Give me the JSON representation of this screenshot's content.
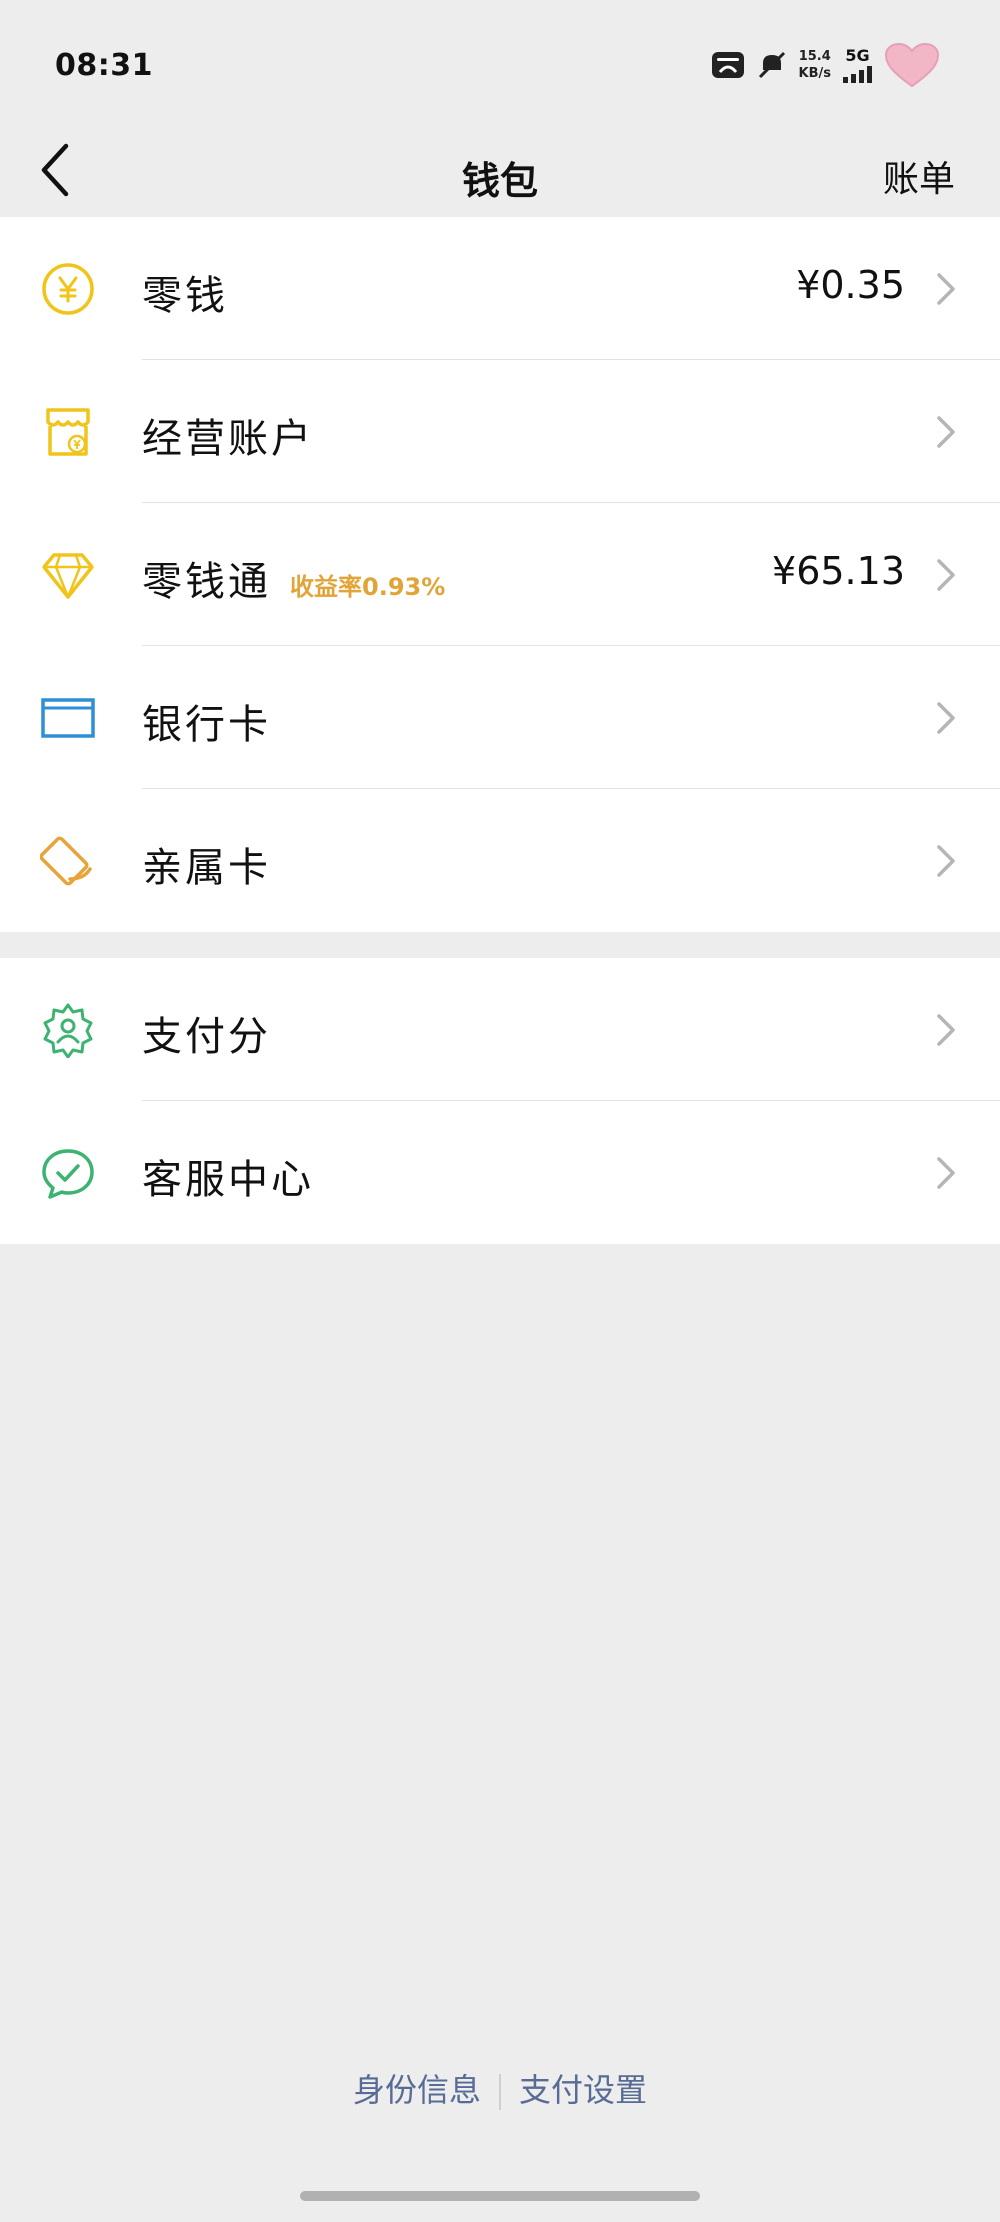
{
  "status_bar": {
    "time": "08:31",
    "net_speed_value": "15.4",
    "net_speed_unit": "KB/s",
    "network": "5G"
  },
  "nav": {
    "title": "钱包",
    "right_label": "账单"
  },
  "menu_group_1": [
    {
      "label": "零钱",
      "amount": "¥0.35",
      "icon": "yuan-coin-icon",
      "icon_color": "#f0c419"
    },
    {
      "label": "经营账户",
      "amount": "",
      "icon": "shop-account-icon",
      "icon_color": "#f0c419"
    },
    {
      "label": "零钱通",
      "tag": "收益率0.93%",
      "amount": "¥65.13",
      "icon": "diamond-icon",
      "icon_color": "#f0c419"
    },
    {
      "label": "银行卡",
      "amount": "",
      "icon": "bank-card-icon",
      "icon_color": "#2d8fd6"
    },
    {
      "label": "亲属卡",
      "amount": "",
      "icon": "family-card-icon",
      "icon_color": "#e7a43a"
    }
  ],
  "menu_group_2": [
    {
      "label": "支付分",
      "icon": "payscore-badge-icon",
      "icon_color": "#3cb371"
    },
    {
      "label": "客服中心",
      "icon": "customer-service-icon",
      "icon_color": "#3cb371"
    }
  ],
  "footer": {
    "left_link": "身份信息",
    "right_link": "支付设置"
  },
  "colors": {
    "link": "#576b95",
    "tag": "#e3a437",
    "background": "#ededed"
  }
}
